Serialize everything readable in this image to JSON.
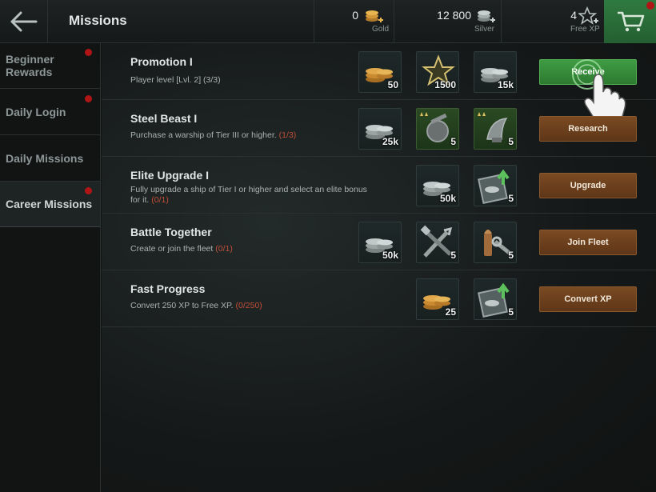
{
  "header": {
    "title": "Missions",
    "back_icon": "arrow-left-icon",
    "gold": {
      "value": "0",
      "label": "Gold"
    },
    "silver": {
      "value": "12 800",
      "label": "Silver"
    },
    "freexp": {
      "value": "4",
      "label": "Free XP"
    },
    "cart_icon": "cart-icon"
  },
  "sidebar": {
    "items": [
      {
        "label": "Beginner Rewards",
        "notify": true
      },
      {
        "label": "Daily Login",
        "notify": true
      },
      {
        "label": "Daily Missions",
        "notify": false
      },
      {
        "label": "Career Missions",
        "notify": true,
        "active": true
      }
    ]
  },
  "missions": [
    {
      "title": "Promotion I",
      "desc": "Player level [Lvl. 2]",
      "progress": "(3/3)",
      "rewards": [
        {
          "icon": "gold-coins-icon",
          "amount": "50"
        },
        {
          "icon": "star-icon",
          "amount": "1500"
        },
        {
          "icon": "silver-coins-icon",
          "amount": "15k"
        }
      ],
      "action": "Receive"
    },
    {
      "title": "Steel Beast I",
      "desc": "Purchase a warship of Tier III or higher.",
      "progress": "(1/3)",
      "rewards": [
        {
          "icon": "silver-coins-icon",
          "amount": "25k"
        },
        {
          "icon": "turret-module-icon",
          "amount": "5"
        },
        {
          "icon": "radar-module-icon",
          "amount": "5"
        }
      ],
      "action": "Research"
    },
    {
      "title": "Elite Upgrade I",
      "desc": "Fully upgrade a ship of Tier I or higher and select an elite bonus for it.",
      "progress": "(0/1)",
      "rewards": [
        {
          "icon": "silver-coins-icon",
          "amount": "50k"
        },
        {
          "icon": "elite-upgrade-icon",
          "amount": "5"
        }
      ],
      "action": "Upgrade"
    },
    {
      "title": "Battle Together",
      "desc": "Create or join the fleet",
      "progress": "(0/1)",
      "rewards": [
        {
          "icon": "silver-coins-icon",
          "amount": "50k"
        },
        {
          "icon": "repair-tools-icon",
          "amount": "5"
        },
        {
          "icon": "shell-wrench-icon",
          "amount": "5"
        }
      ],
      "action": "Join Fleet"
    },
    {
      "title": "Fast Progress",
      "desc": "Convert 250 XP to Free XP.",
      "progress": "(0/250)",
      "rewards": [
        {
          "icon": "gold-coins-icon",
          "amount": "25"
        },
        {
          "icon": "elite-upgrade-icon",
          "amount": "5"
        }
      ],
      "action": "Convert XP"
    }
  ],
  "colors": {
    "accent_green": "#2f7a40",
    "action_brown": "#6e4220",
    "progress_red": "#c04f37"
  }
}
